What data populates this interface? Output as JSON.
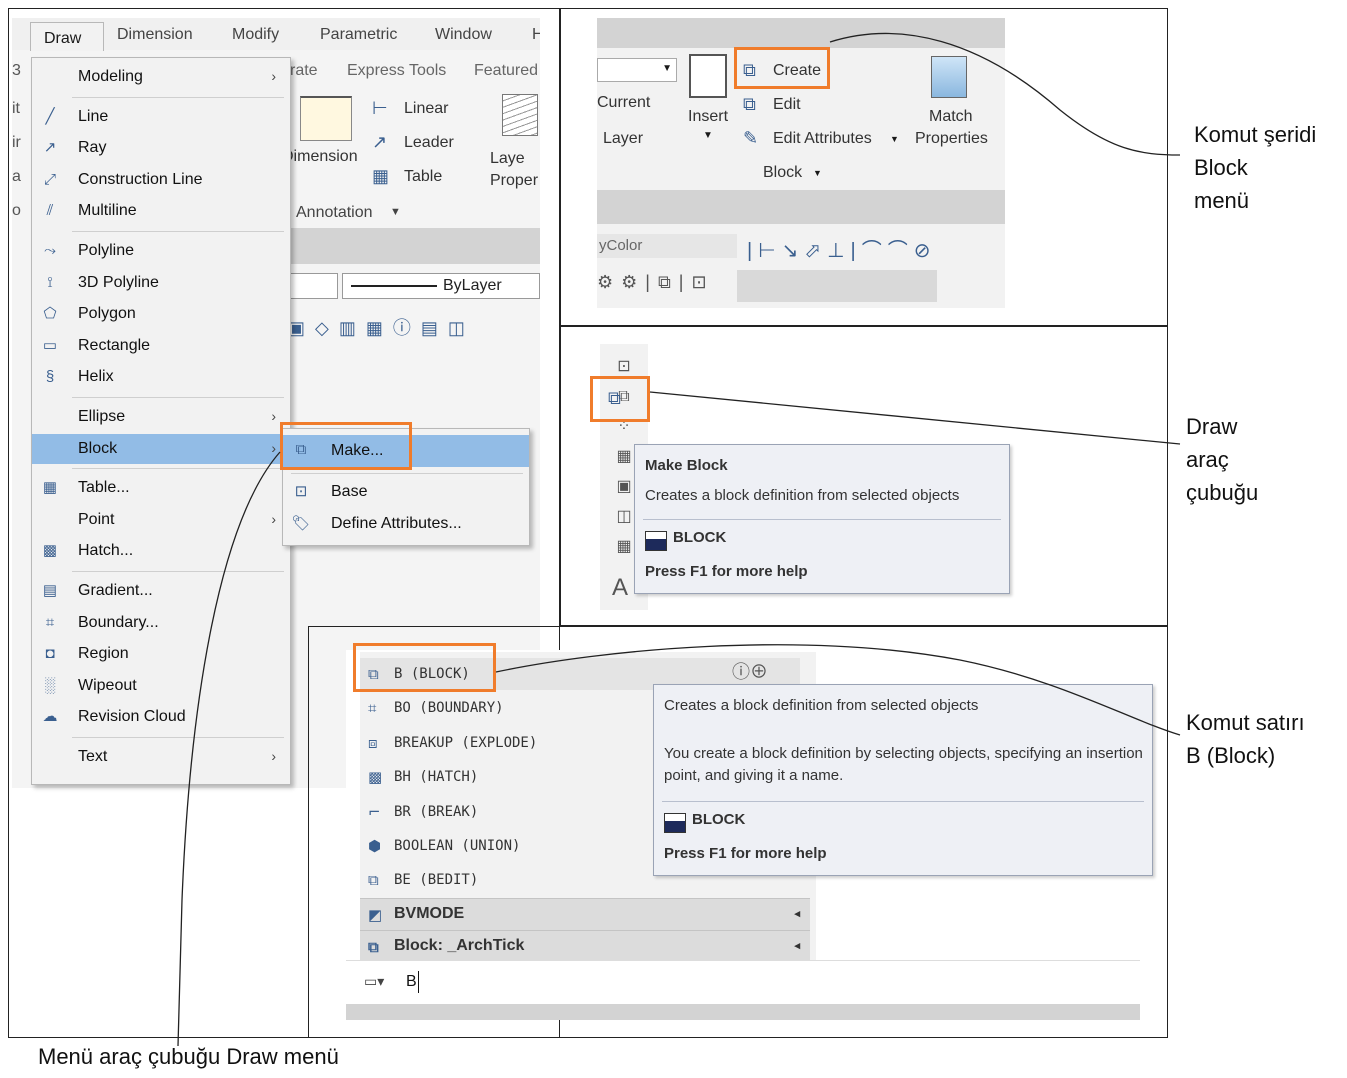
{
  "left_panel": {
    "menubar": [
      "Draw",
      "Dimension",
      "Modify",
      "Parametric",
      "Window",
      "H"
    ],
    "background_fragments": {
      "row1": [
        "rate",
        "Express Tools",
        "Featured"
      ],
      "dimension": "Dimension",
      "linear": "Linear",
      "leader": "Leader",
      "table": "Table",
      "layer_props": "Laye\nProper",
      "annotation": "Annotation",
      "bylayer": "ByLayer",
      "left_edge": [
        "3",
        "it",
        "ir",
        "a",
        "o"
      ]
    },
    "draw_menu": [
      {
        "label": "Modeling",
        "icon": "none",
        "submenu": true
      },
      {
        "label": "Line",
        "icon": "line-icon"
      },
      {
        "label": "Ray",
        "icon": "ray-icon"
      },
      {
        "label": "Construction Line",
        "icon": "construction-line-icon"
      },
      {
        "label": "Multiline",
        "icon": "multiline-icon"
      },
      {
        "label": "Polyline",
        "icon": "polyline-icon"
      },
      {
        "label": "3D Polyline",
        "icon": "3d-polyline-icon"
      },
      {
        "label": "Polygon",
        "icon": "polygon-icon"
      },
      {
        "label": "Rectangle",
        "icon": "rectangle-icon"
      },
      {
        "label": "Helix",
        "icon": "helix-icon"
      },
      {
        "label": "Ellipse",
        "icon": "none",
        "submenu": true
      },
      {
        "label": "Block",
        "icon": "none",
        "submenu": true,
        "selected": true
      },
      {
        "label": "Table...",
        "icon": "table-icon"
      },
      {
        "label": "Point",
        "icon": "none",
        "submenu": true
      },
      {
        "label": "Hatch...",
        "icon": "hatch-icon"
      },
      {
        "label": "Gradient...",
        "icon": "gradient-icon"
      },
      {
        "label": "Boundary...",
        "icon": "boundary-icon"
      },
      {
        "label": "Region",
        "icon": "region-icon"
      },
      {
        "label": "Wipeout",
        "icon": "wipeout-icon"
      },
      {
        "label": "Revision Cloud",
        "icon": "revision-cloud-icon"
      },
      {
        "label": "Text",
        "icon": "none",
        "submenu": true
      }
    ],
    "block_submenu": [
      "Make...",
      "Base",
      "Define Attributes..."
    ]
  },
  "ribbon_panel": {
    "current_layer": [
      "Current",
      "Layer"
    ],
    "insert": "Insert",
    "create": "Create",
    "edit": "Edit",
    "edit_attributes": "Edit Attributes",
    "block": "Block",
    "match_properties": [
      "Match",
      "Properties"
    ],
    "color_field": "yColor"
  },
  "toolbar_panel": {
    "tooltip_title": "Make Block",
    "tooltip_desc": "Creates a block definition from selected objects",
    "command": "BLOCK",
    "help": "Press F1 for more help",
    "text_icon": "A"
  },
  "cmdline_panel": {
    "suggestions": [
      {
        "text": "B (BLOCK)",
        "icon": "block-create-icon"
      },
      {
        "text": "BO (BOUNDARY)",
        "icon": "boundary-icon"
      },
      {
        "text": "BREAKUP (EXPLODE)",
        "icon": "explode-icon"
      },
      {
        "text": "BH (HATCH)",
        "icon": "hatch-icon"
      },
      {
        "text": "BR (BREAK)",
        "icon": "break-icon"
      },
      {
        "text": "BOOLEAN (UNION)",
        "icon": "union-icon"
      },
      {
        "text": "BE (BEDIT)",
        "icon": "bedit-icon"
      }
    ],
    "groups": [
      "BVMODE",
      "Block: _ArchTick"
    ],
    "tooltip_desc1": "Creates a block definition from selected objects",
    "tooltip_desc2": "You create a block definition by selecting objects, specifying an insertion point, and giving it a name.",
    "command": "BLOCK",
    "help": "Press F1 for more help",
    "input": "B"
  },
  "annotations": {
    "ribbon": [
      "Komut şeridi",
      "Block",
      "menü"
    ],
    "toolbar": [
      "Draw",
      "araç",
      "çubuğu"
    ],
    "cmdline": [
      "Komut satırı",
      "B (Block)"
    ],
    "menubar": "Menü araç çubuğu Draw menü"
  },
  "colors": {
    "highlight": "#f07c2b",
    "selection": "#92bce6"
  }
}
